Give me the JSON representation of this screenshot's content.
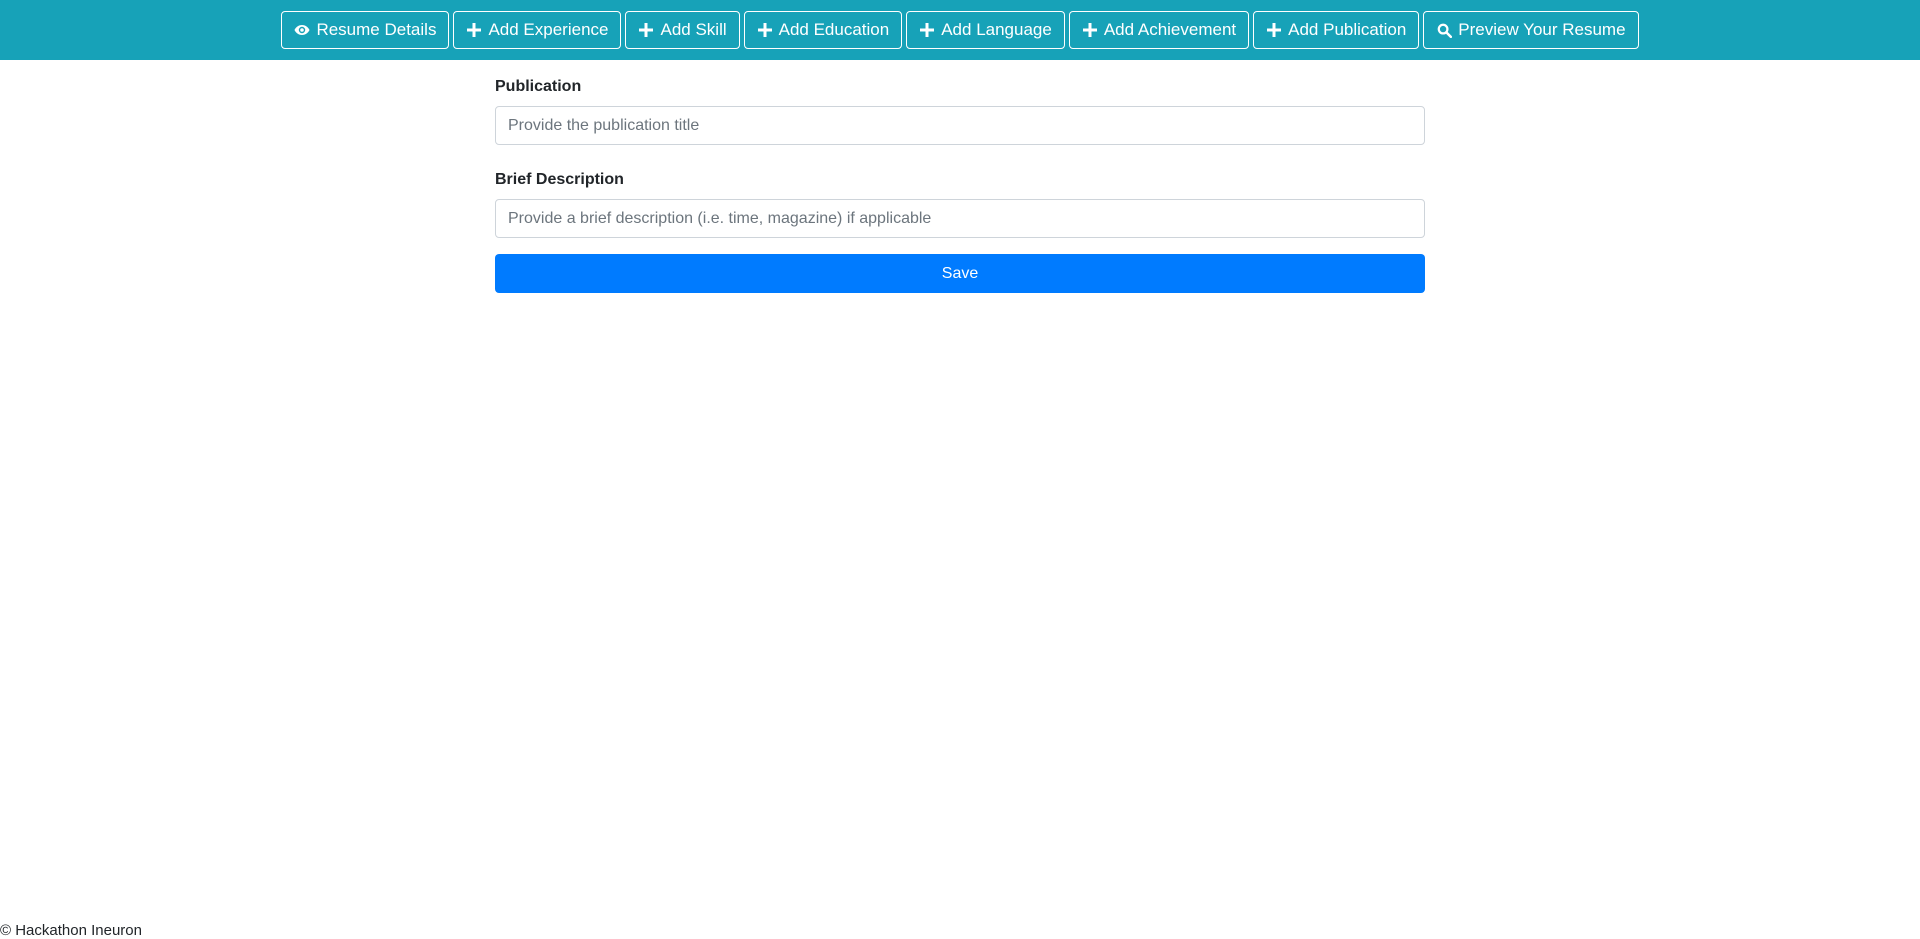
{
  "nav": {
    "items": [
      {
        "label": "Resume Details",
        "icon": "eye-icon"
      },
      {
        "label": "Add Experience",
        "icon": "plus-icon"
      },
      {
        "label": "Add Skill",
        "icon": "plus-icon"
      },
      {
        "label": "Add Education",
        "icon": "plus-icon"
      },
      {
        "label": "Add Language",
        "icon": "plus-icon"
      },
      {
        "label": "Add Achievement",
        "icon": "plus-icon"
      },
      {
        "label": "Add Publication",
        "icon": "plus-icon"
      },
      {
        "label": "Preview Your Resume",
        "icon": "search-icon"
      }
    ]
  },
  "form": {
    "publication_label": "Publication",
    "publication_placeholder": "Provide the publication title",
    "publication_value": "",
    "description_label": "Brief Description",
    "description_placeholder": "Provide a brief description (i.e. time, magazine) if applicable",
    "description_value": "",
    "save_label": "Save"
  },
  "footer": {
    "text": "© Hackathon Ineuron"
  },
  "colors": {
    "topbar": "#17a2b8",
    "save_button": "#007bff"
  }
}
